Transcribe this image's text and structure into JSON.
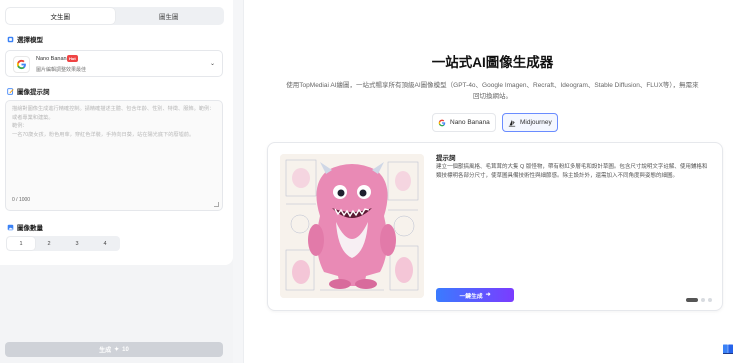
{
  "tabs": [
    {
      "label": "文生圖",
      "active": true
    },
    {
      "label": "圖生圖",
      "active": false
    }
  ],
  "model_section": {
    "title": "選擇模型",
    "selected": {
      "name": "Nano Banana",
      "badge": "Hot",
      "description": "圖片編輯調整效果最佳"
    }
  },
  "prompt_section": {
    "title": "圖像提示詞",
    "placeholder": "描繪對圖像生成進行精確控制。請精確描述主體、包含年齡、性別、特徵、服飾。範例：或者專業和建築。\n範例：\n一名70歲女孩，粉色用傘，穿紅色洋裝，手持向日葵，站在陽光底下的廢墟前。",
    "counter": "0 / 1000"
  },
  "count_section": {
    "title": "圖像數量",
    "options": [
      "1",
      "2",
      "3",
      "4"
    ],
    "selected": "1"
  },
  "generate_button": {
    "label": "生成",
    "cost": "10"
  },
  "hero": {
    "title": "一站式AI圖像生成器",
    "subtitle": "使用TopMediai AI繪圖，一站式暢享所有頂級AI圖像模型（GPT-4o、Google Imagen、Recraft、Ideogram、Stable Diffusion、FLUX等），無需來回切換網站。"
  },
  "model_chips": [
    {
      "label": "Nano Banana",
      "icon": "google-icon",
      "active": false
    },
    {
      "label": "Midjourney",
      "icon": "midjourney-icon",
      "active": true
    }
  ],
  "example": {
    "title": "提示詞",
    "text": "建立一個獸搞風格、毛茸茸的大隻 Q 版怪物，帶有粉紅多層毛和設計草圖。包含尺寸說明文字註解、使用鋪格和類技標明各部分尺寸，使草圖具備技術性與細節感。除主設計外，還需加入不同角度與姿態的細圖。",
    "button_label": "一鍵生成",
    "slides": 3,
    "active_slide": 0
  },
  "colors": {
    "accent_start": "#3a7bff",
    "accent_end": "#7b3cff",
    "hot_badge": "#ef4444",
    "disabled_button": "#cfd2d8"
  },
  "icons": {
    "model_section": "cube-icon",
    "prompt_section": "edit-icon",
    "count_section": "image-icon",
    "corner": "book-icon"
  }
}
